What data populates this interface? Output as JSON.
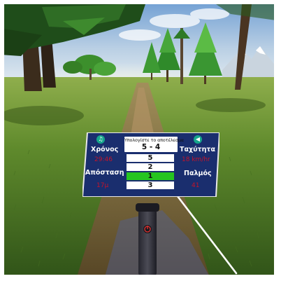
{
  "hud": {
    "question": "Υπολογίστε το αποτέλεσμα",
    "expression": "5 - 4",
    "answers": [
      "5",
      "2",
      "1",
      "3"
    ],
    "selected_answer": "1",
    "time_label": "Χρόνος",
    "time_value": "29:46",
    "distance_label": "Απόσταση",
    "distance_value": "17μ",
    "speed_label": "Ταχύτητα",
    "speed_value": "18 km/hr",
    "pulse_label": "Παλμός",
    "pulse_value": "41",
    "music_icon": "music-note-icon",
    "sound_icon": "speaker-icon"
  },
  "colors": {
    "panel_bg": "#1a2e6e",
    "panel_border": "#e8e8e8",
    "value_red": "#c4142a",
    "selected_green": "#26c520",
    "icon_teal": "#16a68c"
  }
}
